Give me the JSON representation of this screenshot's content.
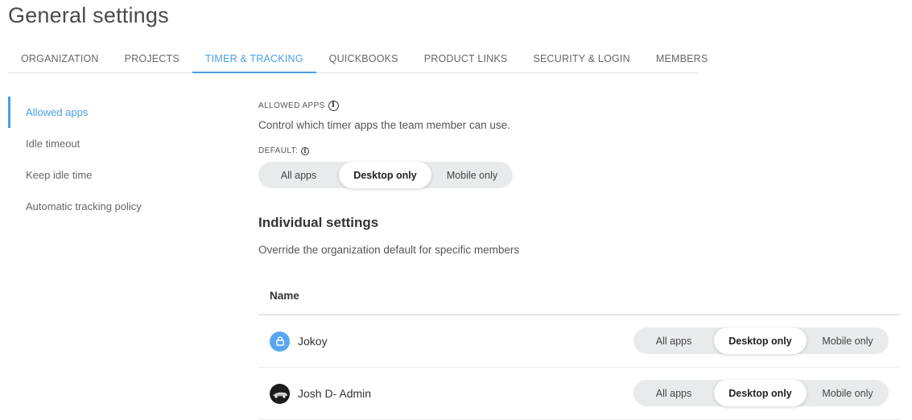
{
  "page": {
    "title": "General settings"
  },
  "tabs": [
    {
      "label": "ORGANIZATION",
      "active": false
    },
    {
      "label": "PROJECTS",
      "active": false
    },
    {
      "label": "TIMER & TRACKING",
      "active": true
    },
    {
      "label": "QUICKBOOKS",
      "active": false
    },
    {
      "label": "PRODUCT LINKS",
      "active": false
    },
    {
      "label": "SECURITY & LOGIN",
      "active": false
    },
    {
      "label": "MEMBERS",
      "active": false
    }
  ],
  "sidebar": {
    "items": [
      {
        "label": "Allowed apps",
        "active": true
      },
      {
        "label": "Idle timeout",
        "active": false
      },
      {
        "label": "Keep idle time",
        "active": false
      },
      {
        "label": "Automatic tracking policy",
        "active": false
      }
    ]
  },
  "allowed_apps": {
    "label": "ALLOWED APPS",
    "description": "Control which timer apps the team member can use.",
    "default_label": "DEFAULT:",
    "options": [
      "All apps",
      "Desktop only",
      "Mobile only"
    ],
    "selected": "Desktop only"
  },
  "individual": {
    "title": "Individual settings",
    "description": "Override the organization default for specific members",
    "column_name": "Name",
    "members": [
      {
        "name": "Jokoy",
        "avatar": "person-icon",
        "selected": "Desktop only"
      },
      {
        "name": "Josh D- Admin",
        "avatar": "car-photo-avatar",
        "selected": "Desktop only"
      }
    ]
  },
  "colors": {
    "accent": "#4a9fe0",
    "segment_bg": "#e9eaeb",
    "avatar_blue": "#5aa6f0"
  },
  "icons": {
    "info": "info-icon"
  }
}
